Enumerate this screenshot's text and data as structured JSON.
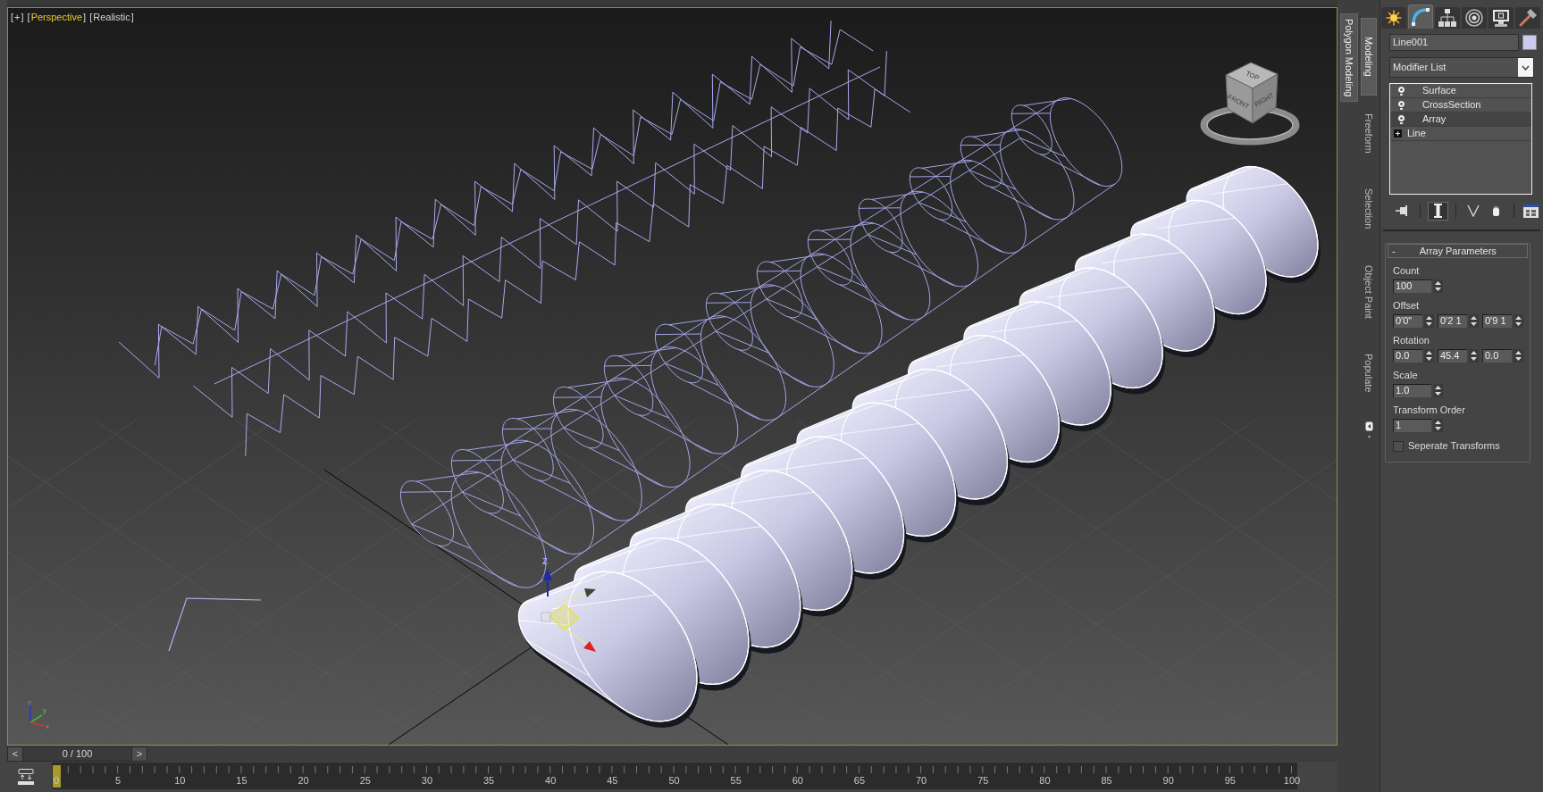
{
  "viewport": {
    "labels": [
      {
        "open": "[",
        "text": "+",
        "close": "]",
        "active": false
      },
      {
        "open": "[",
        "text": "Perspective",
        "close": "]",
        "active": true
      },
      {
        "open": "[",
        "text": "Realistic",
        "close": "]",
        "active": false
      }
    ],
    "view_cube": {
      "faces": [
        "TOP",
        "FRONT",
        "RIGHT"
      ]
    },
    "gizmo": {
      "labels": [
        "z"
      ]
    },
    "axis_tripod": {
      "labels": [
        "z",
        "y",
        "x"
      ]
    }
  },
  "time_slider": {
    "prev": "<",
    "position": "0 / 100",
    "next": ">",
    "level": 0
  },
  "timeline": {
    "labels": [
      "0",
      "5",
      "10",
      "15",
      "20",
      "25",
      "30",
      "35",
      "40",
      "45",
      "50",
      "55",
      "60",
      "65",
      "70",
      "75",
      "80",
      "85",
      "90",
      "95",
      "100"
    ],
    "level": 0
  },
  "ribbon_tabs": [
    {
      "label": "Polygon Modeling",
      "selected": true
    }
  ],
  "ribbon_subtabs": [
    {
      "label": "Modeling",
      "selected": true
    },
    {
      "label": "Freeform",
      "selected": false
    },
    {
      "label": "Selection",
      "selected": false
    },
    {
      "label": "Object Paint",
      "selected": false
    },
    {
      "label": "Populate",
      "selected": false
    }
  ],
  "command_panel": {
    "tabs": [
      {
        "kind": "create",
        "selected": false
      },
      {
        "kind": "modify",
        "selected": true
      },
      {
        "kind": "hierarchy",
        "selected": false
      },
      {
        "kind": "motion",
        "selected": false
      },
      {
        "kind": "display",
        "selected": false
      },
      {
        "kind": "utilities",
        "selected": false
      }
    ],
    "object_name": "Line001",
    "modifier_list": "Modifier List",
    "stack": [
      {
        "kind": "modifier",
        "label": "Surface",
        "selected": false
      },
      {
        "kind": "modifier",
        "label": "CrossSection",
        "selected": false
      },
      {
        "kind": "modifier",
        "label": "Array",
        "selected": true
      },
      {
        "kind": "base",
        "label": "Line",
        "selected": false
      }
    ],
    "stack_tools": [
      {
        "kind": "pin",
        "selected": false
      },
      {
        "kind": "end_result",
        "selected": true
      },
      {
        "kind": "unique",
        "selected": false
      },
      {
        "kind": "remove",
        "selected": false
      },
      {
        "kind": "configure",
        "selected": false
      }
    ],
    "rollout": {
      "toggle": "-",
      "title": "Array Parameters",
      "params": [
        {
          "label": "Count",
          "fields": [
            "100"
          ]
        },
        {
          "label": "Offset",
          "fields": [
            "0'0\"",
            "0'2 1",
            "0'9 1"
          ]
        },
        {
          "label": "Rotation",
          "fields": [
            "0.0",
            "45.4",
            "0.0"
          ]
        },
        {
          "label": "Scale",
          "fields": [
            "1.0"
          ]
        },
        {
          "label": "Transform Order",
          "fields": [
            "1"
          ]
        }
      ],
      "checkbox": {
        "label": "Seperate Transforms",
        "checked": false
      }
    }
  }
}
